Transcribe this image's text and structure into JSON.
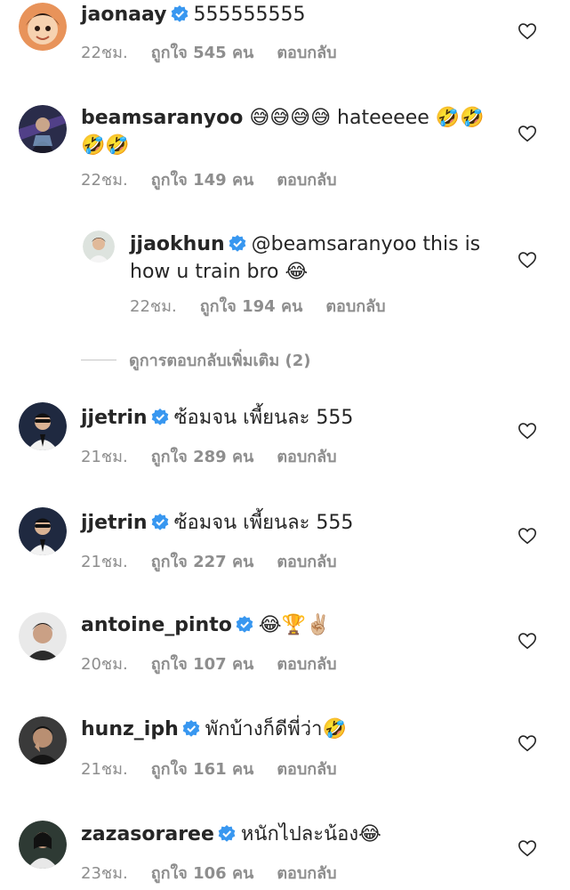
{
  "comments": [
    {
      "username": "jaonaay",
      "text": "555555555",
      "time": "22ชม.",
      "likes": "ถูกใจ 545 คน",
      "reply": "ตอบกลับ"
    },
    {
      "username": "beamsaranyoo",
      "text": "😅😅😅😅 hateeeee 🤣🤣🤣🤣",
      "time": "22ชม.",
      "likes": "ถูกใจ 149 คน",
      "reply": "ตอบกลับ"
    },
    {
      "username": "jjaokhun",
      "text": "@beamsaranyoo this is how u train bro 😂",
      "time": "22ชม.",
      "likes": "ถูกใจ 194 คน",
      "reply": "ตอบกลับ"
    },
    {
      "username": "jjetrin",
      "text": "ซ้อมจน เพี้ยนละ 555",
      "time": "21ชม.",
      "likes": "ถูกใจ 289 คน",
      "reply": "ตอบกลับ"
    },
    {
      "username": "jjetrin",
      "text": "ซ้อมจน เพี้ยนละ 555",
      "time": "21ชม.",
      "likes": "ถูกใจ 227 คน",
      "reply": "ตอบกลับ"
    },
    {
      "username": "antoine_pinto",
      "text": "😂🏆✌🏼",
      "time": "20ชม.",
      "likes": "ถูกใจ 107 คน",
      "reply": "ตอบกลับ"
    },
    {
      "username": "hunz_iph",
      "text": "พักบ้างก็ดีพี่ว่า🤣",
      "time": "21ชม.",
      "likes": "ถูกใจ 161 คน",
      "reply": "ตอบกลับ"
    },
    {
      "username": "zazasoraree",
      "text": "หนักไปละน้อง😂",
      "time": "23ชม.",
      "likes": "ถูกใจ 106 คน",
      "reply": "ตอบกลับ"
    }
  ],
  "view_replies": "ดูการตอบกลับเพิ่มเติม (2)",
  "colors": {
    "verified": "#3897f0",
    "muted": "#8e8e8e",
    "text": "#262626"
  }
}
